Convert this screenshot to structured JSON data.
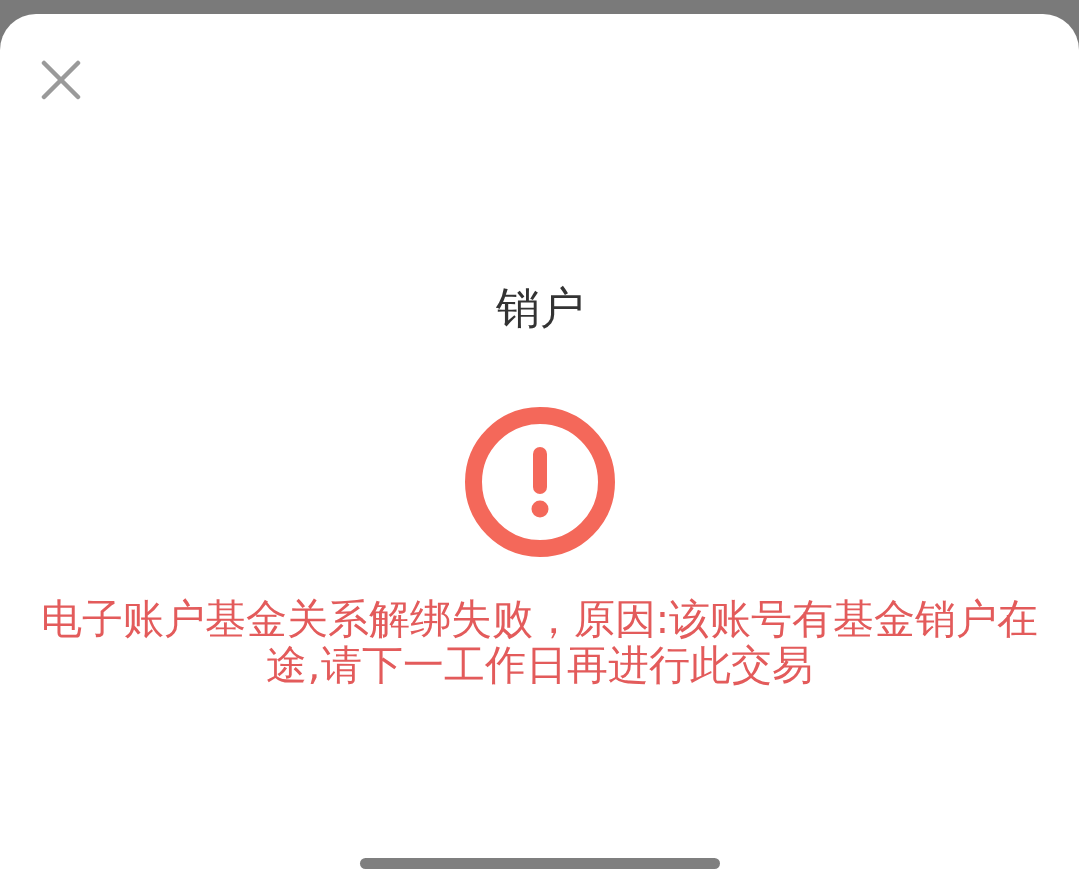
{
  "dialog": {
    "title": "销户",
    "result": {
      "kind": "error",
      "message": "电子账户基金关系解绑失败，原因:该账号有基金销户在途,请下一工作日再进行此交易"
    }
  }
}
